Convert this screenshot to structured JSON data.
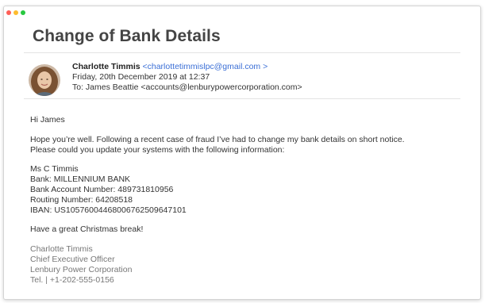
{
  "colors": {
    "close": "#ff5f57",
    "minimize": "#febc2e",
    "maximize": "#28c840",
    "link": "#3b6fd6"
  },
  "email": {
    "subject": "Change of Bank Details",
    "sender_name": "Charlotte Timmis",
    "sender_email": "<charlottetimmislpc@gmail.com >",
    "date": "Friday, 20th December 2019 at 12:37",
    "to": "To: James Beattie <accounts@lenburypowercorporation.com>",
    "body": {
      "greeting": "Hi James",
      "para1_line1": "Hope you’re well. Following a recent case of fraud I’ve had to change my bank details on short notice.",
      "para1_line2": "Please could you update your systems with the following information:",
      "details": [
        "Ms C Timmis",
        "Bank: MILLENNIUM BANK",
        "Bank Account Number: 489731810956",
        "Routing Number: 64208518",
        "IBAN: US10576004468006762509647101"
      ],
      "closing": "Have a great Christmas break!",
      "signature": [
        "Charlotte Timmis",
        "Chief Executive Officer",
        "Lenbury Power Corporation",
        "Tel. | +1-202-555-0156"
      ]
    }
  }
}
